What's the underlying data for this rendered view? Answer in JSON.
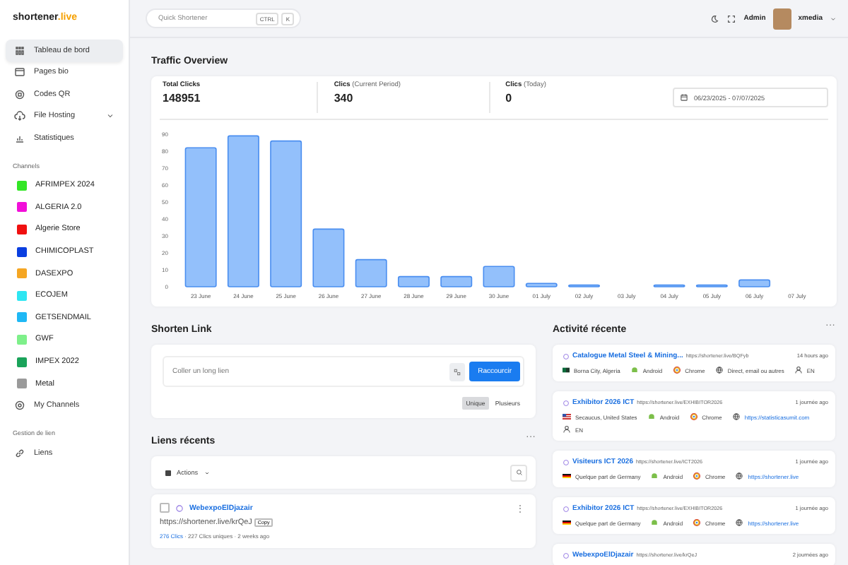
{
  "brand": {
    "name": "shortener",
    "suffix": ".live"
  },
  "header": {
    "search": {
      "placeholder": "Quick Shortener",
      "shortcut": [
        "CTRL",
        "K"
      ]
    },
    "user": {
      "role": "Admin",
      "name": "xmedia"
    }
  },
  "sidebar": {
    "items": [
      {
        "label": "Tableau de bord",
        "selected": true,
        "expandable": false
      },
      {
        "label": "Pages bio",
        "selected": false,
        "expandable": false
      },
      {
        "label": "Codes QR",
        "selected": false,
        "expandable": false
      },
      {
        "label": "File Hosting",
        "selected": false,
        "expandable": true
      },
      {
        "label": "Statistiques",
        "selected": false,
        "expandable": false
      }
    ],
    "channels_heading": "Channels",
    "channels": [
      {
        "label": "AFRIMPEX 2024",
        "color": "#33e626"
      },
      {
        "label": "ALGERIA 2.0",
        "color": "#f20fd9"
      },
      {
        "label": "Algerie Store",
        "color": "#f01010"
      },
      {
        "label": "CHIMICOPLAST",
        "color": "#0a3fe0"
      },
      {
        "label": "DASEXPO",
        "color": "#f5a623"
      },
      {
        "label": "ECOJEM",
        "color": "#2ee6f2"
      },
      {
        "label": "GETSENDMAIL",
        "color": "#1fb8f5"
      },
      {
        "label": "GWF",
        "color": "#7ef08a"
      },
      {
        "label": "IMPEX 2022",
        "color": "#1aa35a"
      },
      {
        "label": "Metal",
        "color": "#9a9a9a"
      }
    ],
    "my_channels": "My Channels",
    "links_heading": "Gestion de lien",
    "link_items": [
      {
        "label": "Liens",
        "selected": false
      }
    ]
  },
  "traffic": {
    "title": "Traffic Overview",
    "stats": [
      {
        "label": "Total Clicks",
        "value": "148951"
      },
      {
        "label": "Clics",
        "note": "(Current Period)",
        "value": "340"
      },
      {
        "label": "Clics",
        "note": "(Today)",
        "value": "0"
      }
    ],
    "date_range": "06/23/2025 - 07/07/2025",
    "chart_data": {
      "type": "bar",
      "categories": [
        "23 June",
        "24 June",
        "25 June",
        "26 June",
        "27 June",
        "28 June",
        "29 June",
        "30 June",
        "01 July",
        "02 July",
        "03 July",
        "04 July",
        "05 July",
        "06 July",
        "07 July"
      ],
      "series": [
        {
          "color": "#93c0fb",
          "values": [
            82,
            89,
            86,
            34,
            16,
            6,
            6,
            12,
            2,
            1,
            0,
            1,
            1,
            4,
            0
          ]
        }
      ],
      "ylim": [
        0,
        90
      ],
      "yticks": [
        0,
        10,
        20,
        30,
        40,
        50,
        60,
        70,
        80,
        90
      ]
    }
  },
  "shorten": {
    "title": "Shorten Link",
    "placeholder": "Coller un long lien",
    "submit": "Raccourcir",
    "modes": [
      {
        "label": "Unique",
        "selected": true
      },
      {
        "label": "Plusieurs",
        "selected": false
      }
    ]
  },
  "recent_links": {
    "title": "Liens récents",
    "menu_glyph": "···",
    "actions": "Actions",
    "links": [
      {
        "title": "WebexpoElDjazair",
        "url": "https://shortener.live/krQeJ",
        "copy": "Copy",
        "menu_glyph": "⋮",
        "clicks": "276 Clics",
        "details": "· 227 Clics uniques · 2 weeks ago",
        "checked": false
      }
    ]
  },
  "activity": {
    "title": "Activité récente",
    "menu_glyph": "···",
    "items": [
      {
        "title": "Catalogue Metal Steel & Mining...",
        "url": "https://shortener.live/BQFyb",
        "time": "14 hours ago",
        "location": {
          "kind": "algeria",
          "text": "Borna City, Algeria"
        },
        "os": "Android",
        "browser": "Chrome",
        "source": "Direct, email ou autres",
        "source_is_link": false,
        "lang": "EN"
      },
      {
        "title": "Exhibitor 2026 ICT",
        "url": "https://shortener.live/EXHIBITOR2026",
        "time": "1 journée ago",
        "location": {
          "kind": "usa",
          "text": "Secaucus, United States"
        },
        "os": "Android",
        "browser": "Chrome",
        "source": "https://statisticasumit.com",
        "source_is_link": true,
        "lang": "EN"
      },
      {
        "title": "Visiteurs ICT 2026",
        "url": "https://shortener.live/ICT2026",
        "time": "1 journée ago",
        "location": {
          "kind": "germany",
          "text": "Quelque part de Germany"
        },
        "os": "Android",
        "browser": "Chrome",
        "source": "https://shortener.live",
        "source_is_link": true
      },
      {
        "title": "Exhibitor 2026 ICT",
        "url": "https://shortener.live/EXHIBITOR2026",
        "time": "1 journée ago",
        "location": {
          "kind": "germany",
          "text": "Quelque part de Germany"
        },
        "os": "Android",
        "browser": "Chrome",
        "source": "https://shortener.live",
        "source_is_link": true
      },
      {
        "title": "WebexpoElDjazair",
        "url": "https://shortener.live/krQeJ",
        "time": "2 journées ago"
      }
    ]
  }
}
